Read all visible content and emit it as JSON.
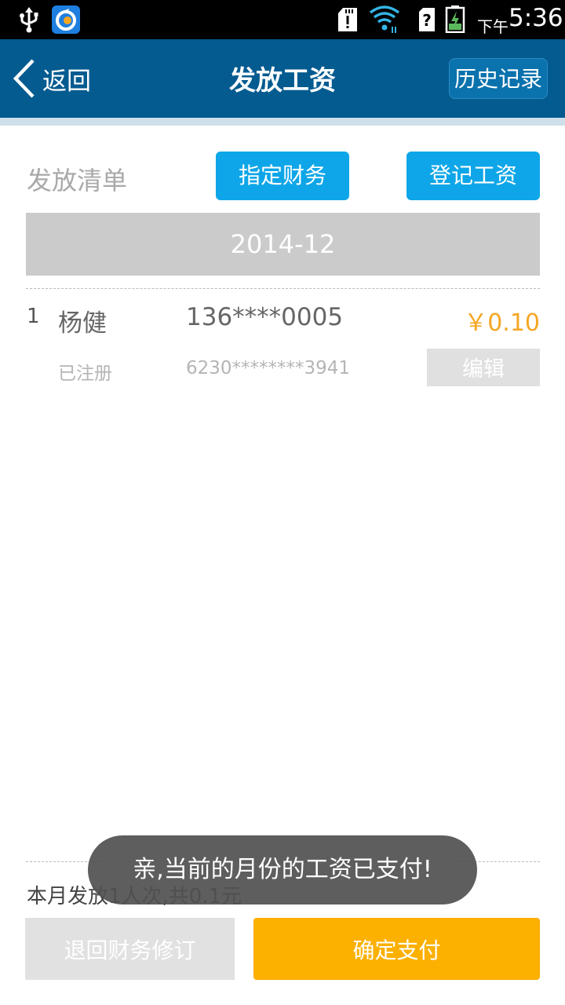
{
  "status_bar": {
    "ampm": "下午",
    "time": "5:36",
    "icons": [
      "usb-icon",
      "app-notification-icon",
      "sd-card-alert-icon",
      "wifi-icon",
      "no-sim-icon",
      "battery-charging-icon"
    ]
  },
  "nav": {
    "back_label": "返回",
    "title": "发放工资",
    "history_label": "历史记录"
  },
  "toolbar": {
    "section_label": "发放清单",
    "assign_label": "指定财务",
    "register_label": "登记工资"
  },
  "month": "2014-12",
  "rows": [
    {
      "index": "1",
      "name": "杨健",
      "phone": "136****0005",
      "amount": "￥0.10",
      "status": "已注册",
      "card": "6230********3941",
      "edit_label": "编辑"
    }
  ],
  "summary": "本月发放1人次,共0.1元",
  "actions": {
    "return_label": "退回财务修订",
    "confirm_label": "确定支付"
  },
  "toast": "亲,当前的月份的工资已支付!",
  "colors": {
    "nav_bg": "#045b90",
    "accent_blue": "#0ea6e8",
    "accent_orange": "#fcb000",
    "amount": "#f5a623"
  }
}
